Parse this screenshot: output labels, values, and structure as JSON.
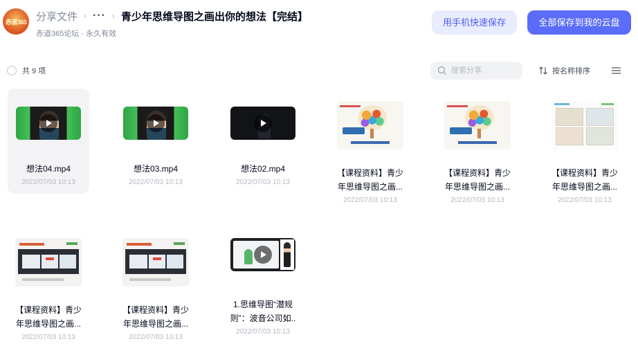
{
  "header": {
    "avatar_text": "赤道365",
    "breadcrumb_root": "分享文件",
    "breadcrumb_more": "···",
    "title": "青少年思维导图之画出你的想法【完结】",
    "sub_info": "赤道365论坛 · 永久有效",
    "phone_save_label": "用手机快速保存",
    "save_all_label": "全部保存到我的云盘"
  },
  "toolbar": {
    "count_text": "共 9 项",
    "search_placeholder": "搜索分享",
    "sort_label": "按名称排序"
  },
  "colors": {
    "accent": "#5b6cf8",
    "accent_light": "#e9ecfd",
    "text_primary": "#03081a",
    "text_muted": "#b4b8c2"
  },
  "files": [
    {
      "line1": "想法04.mp4",
      "line2": "",
      "date": "2022/07/03 10:13",
      "kind": "video",
      "icon": "video-thumbnail",
      "selected": true
    },
    {
      "line1": "想法03.mp4",
      "line2": "",
      "date": "2022/07/03 10:13",
      "kind": "video",
      "icon": "video-thumbnail",
      "selected": false
    },
    {
      "line1": "想法02.mp4",
      "line2": "",
      "date": "2022/07/03 10:13",
      "kind": "video",
      "icon": "video-thumbnail",
      "selected": false
    },
    {
      "line1": "【课程资料】青少",
      "line2": "年思维导图之画...",
      "date": "2022/07/03 10:13",
      "kind": "document",
      "icon": "document-thumbnail",
      "selected": false
    },
    {
      "line1": "【课程资料】青少",
      "line2": "年思维导图之画...",
      "date": "2022/07/03 10:13",
      "kind": "document",
      "icon": "document-thumbnail",
      "selected": false
    },
    {
      "line1": "【课程资料】青少",
      "line2": "年思维导图之画...",
      "date": "2022/07/03 10:13",
      "kind": "document",
      "icon": "document-thumbnail",
      "selected": false
    },
    {
      "line1": "【课程资料】青少",
      "line2": "年思维导图之画...",
      "date": "2022/07/03 10:13",
      "kind": "document",
      "icon": "document-thumbnail",
      "selected": false
    },
    {
      "line1": "【课程资料】青少",
      "line2": "年思维导图之画...",
      "date": "2022/07/03 10:13",
      "kind": "document",
      "icon": "document-thumbnail",
      "selected": false
    },
    {
      "line1": "1.思维导图“潜规",
      "line2": "则”：波音公司如..",
      "date": "2022/07/03 10:13",
      "kind": "video",
      "icon": "video-thumbnail",
      "selected": false
    }
  ]
}
